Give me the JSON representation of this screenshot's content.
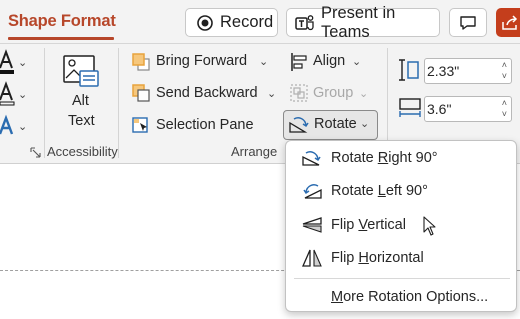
{
  "header": {
    "active_tab": "Shape Format",
    "record_label": "Record",
    "present_label": "Present in Teams",
    "icons": [
      "record-icon",
      "teams-icon",
      "comment-icon",
      "share-icon"
    ]
  },
  "ribbon": {
    "accessibility": {
      "alt_text_line1": "Alt",
      "alt_text_line2": "Text",
      "group_label": "Accessibility"
    },
    "arrange": {
      "bring_forward": "Bring Forward",
      "send_backward": "Send Backward",
      "selection_pane": "Selection Pane",
      "align": "Align",
      "group": "Group",
      "rotate": "Rotate",
      "group_label": "Arrange"
    },
    "size": {
      "height_value": "2.33\"",
      "width_value": "3.6\""
    }
  },
  "rotate_menu": {
    "items": [
      {
        "pre": "Rotate ",
        "key": "R",
        "post": "ight 90°",
        "icon": "rotate-right-icon"
      },
      {
        "pre": "Rotate ",
        "key": "L",
        "post": "eft 90°",
        "icon": "rotate-left-icon"
      },
      {
        "pre": "Flip ",
        "key": "V",
        "post": "ertical",
        "icon": "flip-vertical-icon"
      },
      {
        "pre": "Flip ",
        "key": "H",
        "post": "orizontal",
        "icon": "flip-horizontal-icon"
      },
      {
        "pre": "",
        "key": "M",
        "post": "ore Rotation Options...",
        "icon": ""
      }
    ]
  },
  "colors": {
    "accent": "#b7472a",
    "share": "#c43e1c",
    "icon_blue": "#2b6cb0",
    "icon_orange": "#e8a33d"
  }
}
